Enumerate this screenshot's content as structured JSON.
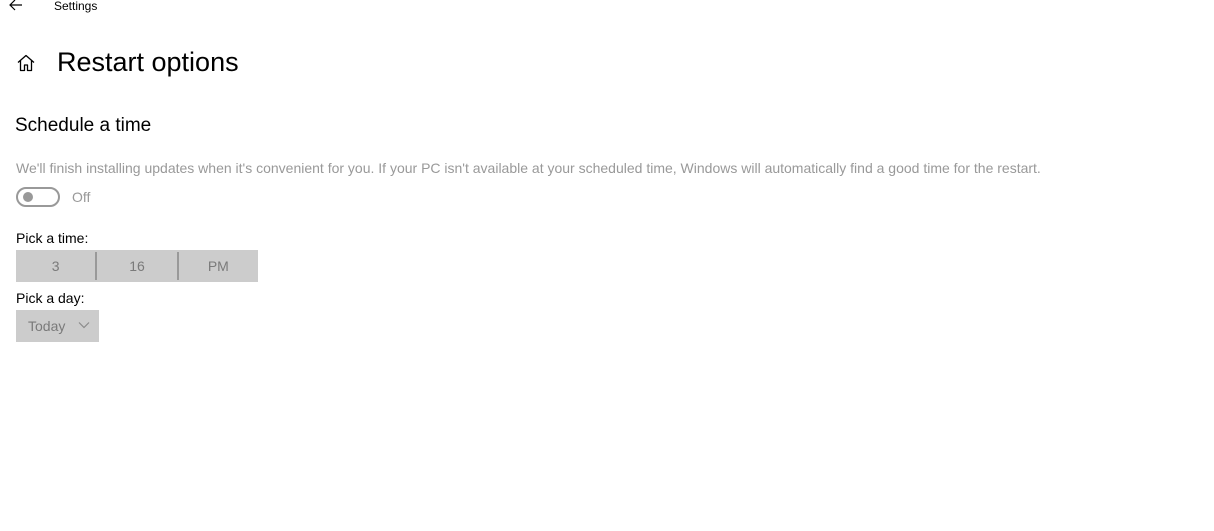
{
  "window": {
    "title": "Settings"
  },
  "header": {
    "title": "Restart options"
  },
  "schedule": {
    "heading": "Schedule a time",
    "description": "We'll finish installing updates when it's convenient for you. If your PC isn't available at your scheduled time, Windows will automatically find a good time for the restart.",
    "toggle_state": "Off",
    "toggle_on": false
  },
  "time": {
    "label": "Pick a time:",
    "hour": "3",
    "minute": "16",
    "period": "PM"
  },
  "day": {
    "label": "Pick a day:",
    "value": "Today"
  },
  "colors": {
    "disabled_text": "#999999",
    "picker_bg": "#cccccc"
  },
  "icons": [
    "back-arrow-icon",
    "home-icon",
    "chevron-down-icon"
  ]
}
